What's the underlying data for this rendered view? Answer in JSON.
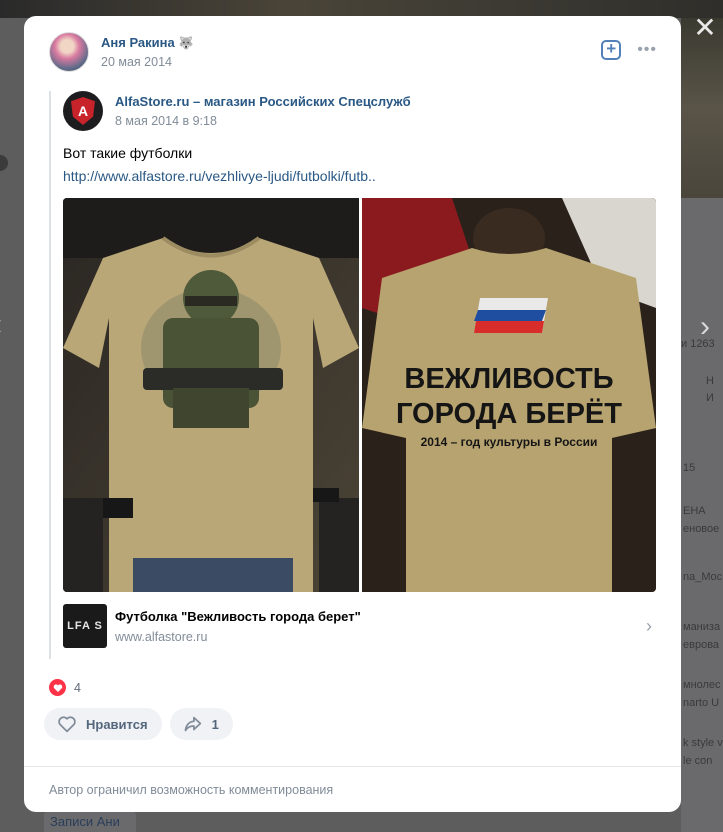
{
  "background": {
    "right_texts": [
      "и 1263",
      "Н",
      "И",
      "15",
      "ЕНА",
      "еновое",
      "na_Moc",
      "маниза",
      "еврова",
      "мнолес",
      "narto U",
      "k style v",
      "le con"
    ],
    "bottom_tab": "Записи Ани",
    "close_symbol": "✕"
  },
  "post": {
    "author": "Аня Ракина",
    "date": "20 мая 2014",
    "add_icon": "plus-square-icon",
    "more_icon": "more-horizontal-icon"
  },
  "repost": {
    "group_name": "AlfaStore.ru – магазин Российских Спецслужб",
    "date": "8 мая 2014 в 9:18",
    "text": "Вот такие футболки",
    "link": "http://www.alfastore.ru/vezhlivye-ljudi/futbolki/futb..",
    "shirt_back_text": {
      "line1": "ВЕЖЛИВОСТЬ",
      "line2": "ГОРОДА БЕРЁТ",
      "line3": "2014 – год культуры в России"
    },
    "link_card": {
      "thumb_text": "LFA S",
      "title": "Футболка \"Вежливость города берет\"",
      "domain": "www.alfastore.ru"
    }
  },
  "reactions": {
    "count": "4",
    "like_label": "Нравится",
    "share_count": "1"
  },
  "footer": {
    "text": "Автор ограничил возможность комментирования"
  },
  "colors": {
    "link": "#2a5885",
    "meta": "#818c99",
    "heart": "#ff3347"
  }
}
